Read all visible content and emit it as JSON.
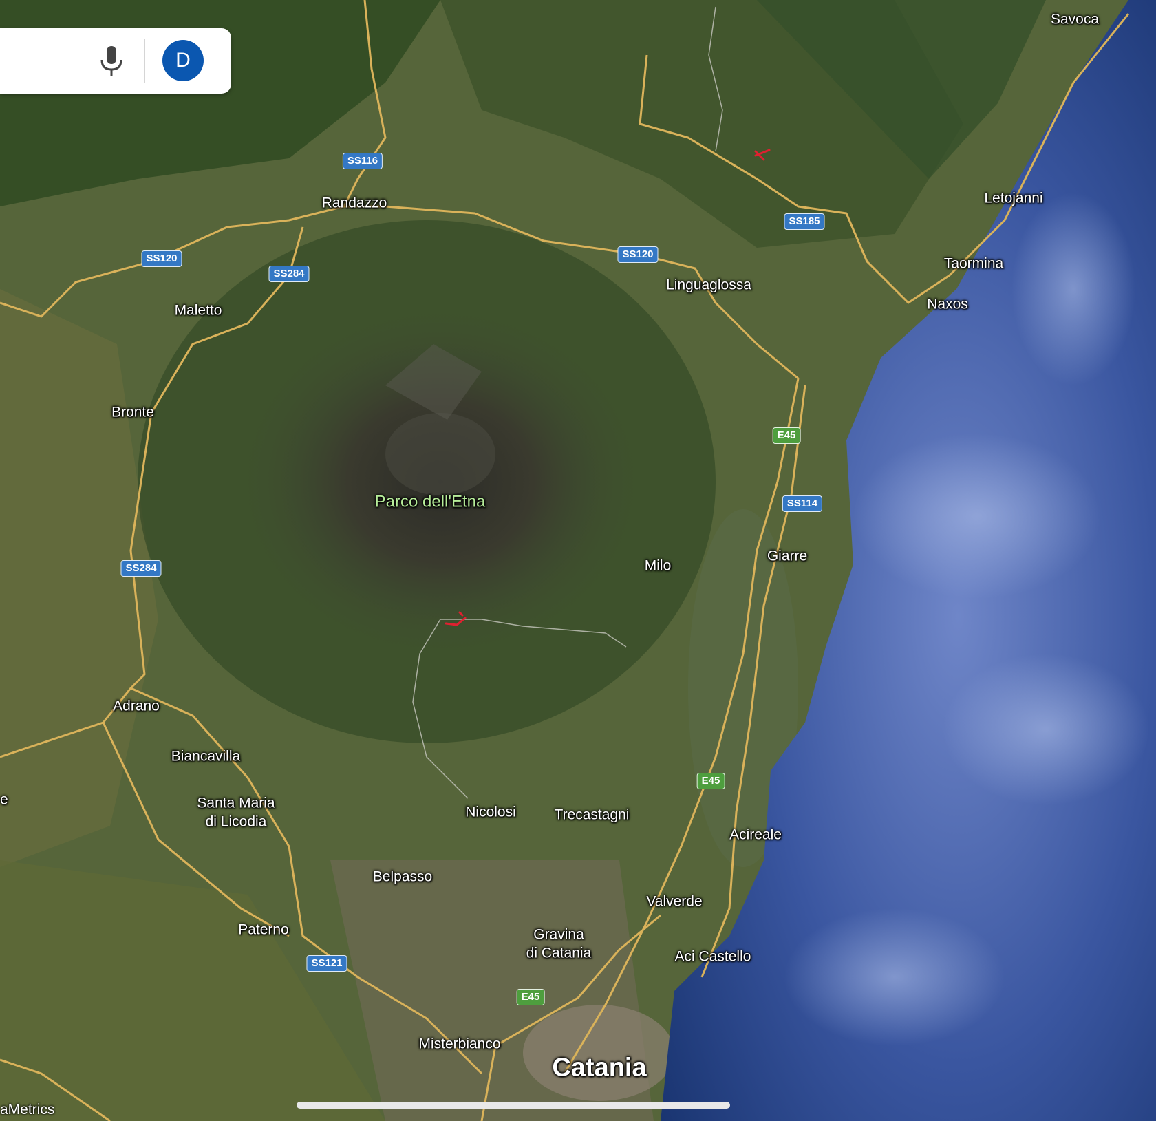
{
  "map": {
    "imagery": "satellite",
    "colors": {
      "land": "#4a5a34",
      "forest": "#2c4a20",
      "volcano": "#3a3a30",
      "sea": "#1a3a78",
      "road": "#d9b25a",
      "urban": "#8a7e6a"
    },
    "places": [
      {
        "name": "Savoca",
        "style": "normal"
      },
      {
        "name": "Randazzo",
        "style": "normal"
      },
      {
        "name": "Letojanni",
        "style": "normal"
      },
      {
        "name": "Taormina",
        "style": "normal"
      },
      {
        "name": "Naxos",
        "style": "normal"
      },
      {
        "name": "Linguaglossa",
        "style": "normal"
      },
      {
        "name": "Maletto",
        "style": "normal"
      },
      {
        "name": "Bronte",
        "style": "normal"
      },
      {
        "name": "Parco dell'Etna",
        "style": "park"
      },
      {
        "name": "Milo",
        "style": "normal"
      },
      {
        "name": "Giarre",
        "style": "normal"
      },
      {
        "name": "Adrano",
        "style": "normal"
      },
      {
        "name": "Biancavilla",
        "style": "normal"
      },
      {
        "name": "Santa Maria\ndi Licodia",
        "style": "normal"
      },
      {
        "name": "Nicolosi",
        "style": "normal"
      },
      {
        "name": "Trecastagni",
        "style": "normal"
      },
      {
        "name": "Acireale",
        "style": "normal"
      },
      {
        "name": "Belpasso",
        "style": "normal"
      },
      {
        "name": "Valverde",
        "style": "normal"
      },
      {
        "name": "Paterno",
        "style": "normal"
      },
      {
        "name": "Gravina\ndi Catania",
        "style": "normal"
      },
      {
        "name": "Aci Castello",
        "style": "normal"
      },
      {
        "name": "Misterbianco",
        "style": "normal"
      },
      {
        "name": "Catania",
        "style": "big"
      },
      {
        "name": "e",
        "style": "edge"
      }
    ],
    "shields": [
      {
        "label": "SS116",
        "color": "blue"
      },
      {
        "label": "SS185",
        "color": "blue"
      },
      {
        "label": "SS120",
        "color": "blue"
      },
      {
        "label": "SS284",
        "color": "blue"
      },
      {
        "label": "SS120",
        "color": "blue"
      },
      {
        "label": "E45",
        "color": "green"
      },
      {
        "label": "SS114",
        "color": "blue"
      },
      {
        "label": "SS284",
        "color": "blue"
      },
      {
        "label": "E45",
        "color": "green"
      },
      {
        "label": "SS121",
        "color": "blue"
      },
      {
        "label": "E45",
        "color": "green"
      }
    ],
    "markers": [
      {
        "type": "red-annotation"
      },
      {
        "type": "red-annotation"
      }
    ]
  },
  "search": {
    "mic_icon": "microphone-icon",
    "avatar_initial": "D"
  },
  "attribution": "aMetrics"
}
